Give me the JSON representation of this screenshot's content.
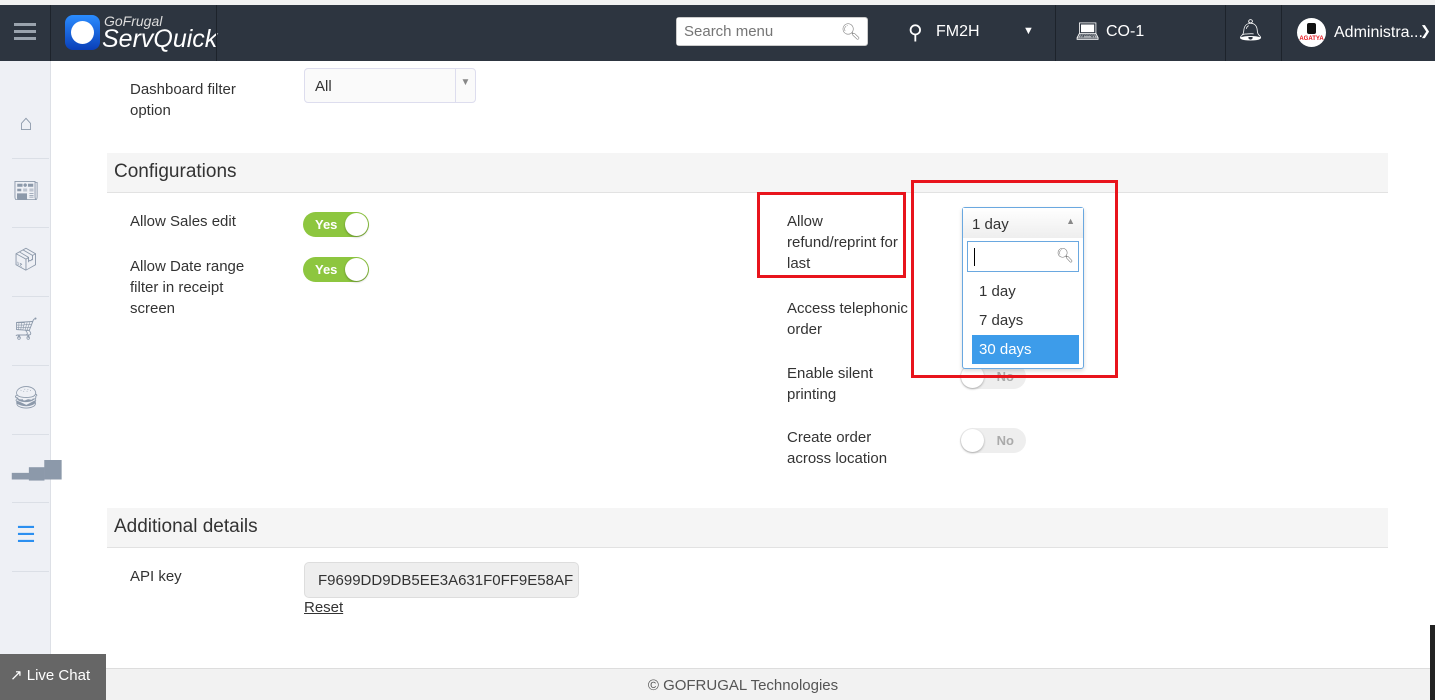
{
  "header": {
    "app_brand_small": "GoFrugal",
    "app_brand": "ServQuick",
    "search_placeholder": "Search menu",
    "location": "FM2H",
    "counter": "CO-1",
    "user": "Administra...",
    "avatar_text": "AGATYA"
  },
  "sidebar": {
    "items": [
      {
        "icon": "home-icon"
      },
      {
        "icon": "catalog-icon"
      },
      {
        "icon": "inventory-icon"
      },
      {
        "icon": "cart-icon"
      },
      {
        "icon": "food-icon"
      },
      {
        "icon": "reports-icon"
      },
      {
        "icon": "settings-sliders-icon",
        "active": true
      }
    ],
    "active_color": "#2b8ff0"
  },
  "dashboard": {
    "label": "Dashboard filter option",
    "value": "All"
  },
  "configurations": {
    "title": "Configurations",
    "left": [
      {
        "label": "Allow Sales edit",
        "value": "Yes"
      },
      {
        "label": "Allow Date range filter in receipt screen",
        "value": "Yes"
      }
    ],
    "right": [
      {
        "label": "Allow refund/reprint for last",
        "value": "1 day"
      },
      {
        "label": "Access telephonic order"
      },
      {
        "label": "Enable silent printing",
        "value": "No"
      },
      {
        "label": "Create order across location",
        "value": "No"
      }
    ],
    "dropdown": {
      "selected": "1 day",
      "search_value": "",
      "options": [
        "1 day",
        "7 days",
        "30 days"
      ],
      "highlighted": "30 days"
    }
  },
  "additional": {
    "title": "Additional details",
    "api_label": "API key",
    "api_value": "F9699DD9DB5EE3A631F0FF9E58AF",
    "reset_label": "Reset"
  },
  "footer": {
    "text": "© GOFRUGAL Technologies"
  },
  "live_chat": {
    "label": "Live Chat"
  },
  "colors": {
    "header": "#2d3540",
    "toggle_on": "#8dc63f",
    "highlight": "#3d9cea",
    "annotation": "#e8141c"
  }
}
